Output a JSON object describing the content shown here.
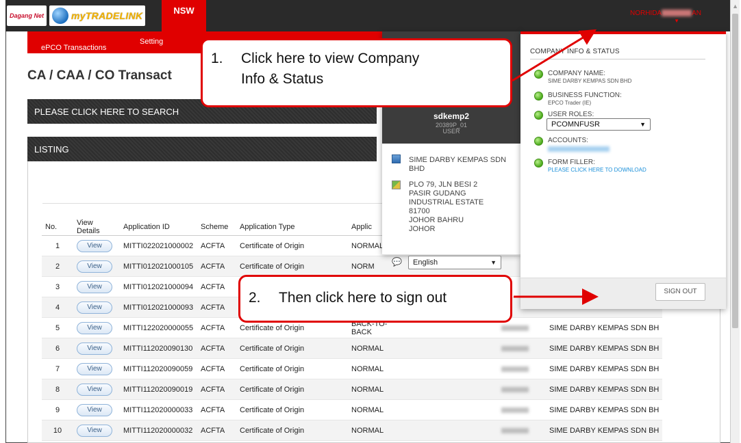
{
  "topbar": {
    "logo_text": "Dagang Net",
    "brand": "myTRADELINK",
    "tab": "NSW",
    "username_visible": "NORHIDA",
    "username_suffix": "AN"
  },
  "nav": {
    "epco": "ePCO Transactions",
    "setting": "Setting"
  },
  "page_title": "CA / CAA / CO Transact",
  "search_bar": "PLEASE CLICK HERE TO SEARCH",
  "listing_bar": "LISTING",
  "table": {
    "headers": [
      "No.",
      "View Details",
      "Application ID",
      "Scheme",
      "Application Type",
      "Applic"
    ],
    "view_label": "View",
    "rows": [
      {
        "no": "1",
        "app_id": "MITTI022021000002",
        "scheme": "ACFTA",
        "type": "Certificate of Origin",
        "app_type": "NORMAL",
        "company": ""
      },
      {
        "no": "2",
        "app_id": "MITTI012021000105",
        "scheme": "ACFTA",
        "type": "Certificate of Origin",
        "app_type": "NORM",
        "company": ""
      },
      {
        "no": "3",
        "app_id": "MITTI012021000094",
        "scheme": "ACFTA",
        "type": "",
        "app_type": "",
        "company": ""
      },
      {
        "no": "4",
        "app_id": "MITTI012021000093",
        "scheme": "ACFTA",
        "type": "",
        "app_type": "",
        "company": ""
      },
      {
        "no": "5",
        "app_id": "MITTI122020000055",
        "scheme": "ACFTA",
        "type": "Certificate of Origin",
        "app_type": "BACK-TO-BACK",
        "company": "SIME DARBY KEMPAS SDN BH"
      },
      {
        "no": "6",
        "app_id": "MITTI112020090130",
        "scheme": "ACFTA",
        "type": "Certificate of Origin",
        "app_type": "NORMAL",
        "company": "SIME DARBY KEMPAS SDN BH"
      },
      {
        "no": "7",
        "app_id": "MITTI112020090059",
        "scheme": "ACFTA",
        "type": "Certificate of Origin",
        "app_type": "NORMAL",
        "company": "SIME DARBY KEMPAS SDN BH"
      },
      {
        "no": "8",
        "app_id": "MITTI112020090019",
        "scheme": "ACFTA",
        "type": "Certificate of Origin",
        "app_type": "NORMAL",
        "company": "SIME DARBY KEMPAS SDN BH"
      },
      {
        "no": "9",
        "app_id": "MITTI112020000033",
        "scheme": "ACFTA",
        "type": "Certificate of Origin",
        "app_type": "NORMAL",
        "company": "SIME DARBY KEMPAS SDN BH"
      },
      {
        "no": "10",
        "app_id": "MITTI112020000032",
        "scheme": "ACFTA",
        "type": "Certificate of Origin",
        "app_type": "NORMAL",
        "company": "SIME DARBY KEMPAS SDN BH"
      }
    ]
  },
  "profile": {
    "user": "sdkemp2",
    "id": "20389P_01",
    "role": "USER",
    "company_lines": [
      "SIME DARBY KEMPAS SDN",
      "BHD"
    ],
    "address_lines": [
      "PLO 79, JLN BESI 2",
      "PASIR GUDANG",
      "INDUSTRIAL ESTATE",
      "81700",
      "JOHOR BAHRU",
      "JOHOR"
    ],
    "language": "English"
  },
  "info": {
    "title": "COMPANY INFO & STATUS",
    "company_label": "COMPANY NAME:",
    "company_value": "SIME DARBY KEMPAS SDN BHD",
    "business_label": "BUSINESS FUNCTION:",
    "business_value": "EPCO Trader (IE)",
    "roles_label": "USER ROLES:",
    "roles_value": "PCOMNFUSR",
    "accounts_label": "ACCOUNTS:",
    "form_label": "FORM FILLER:",
    "form_value": "PLEASE CLICK HERE TO DOWNLOAD",
    "signout": "SIGN OUT"
  },
  "callouts": {
    "c1_num": "1.",
    "c1_line1": "Click here to view Company",
    "c1_line2": "Info & Status",
    "c2_num": "2.",
    "c2_text": "Then click here to sign out"
  }
}
